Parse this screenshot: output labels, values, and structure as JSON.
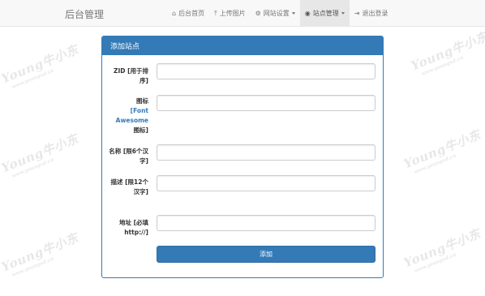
{
  "navbar": {
    "brand": "后台管理",
    "items": [
      {
        "label": "后台首页",
        "icon": "home-icon",
        "glyph": "⌂"
      },
      {
        "label": "上传图片",
        "icon": "upload-icon",
        "glyph": "⤒"
      },
      {
        "label": "网站设置",
        "icon": "gear-icon",
        "glyph": "⚙",
        "dropdown": true
      },
      {
        "label": "站点管理",
        "icon": "globe-icon",
        "glyph": "◉",
        "dropdown": true,
        "active": true
      },
      {
        "label": "退出登录",
        "icon": "sign-out-icon",
        "glyph": "⇥"
      }
    ]
  },
  "panel": {
    "title": "添加站点",
    "fields": [
      {
        "label_parts": [
          "ZID [用于排序]"
        ],
        "value": ""
      },
      {
        "label_before": "图标",
        "label_link": "[Font Awesome",
        "label_after": "图标]",
        "value": ""
      },
      {
        "label_parts": [
          "名称 [限6个汉字]"
        ],
        "value": ""
      },
      {
        "label_parts": [
          "描述 [限12个汉字]"
        ],
        "value": ""
      },
      {
        "label_parts": [
          "地址 [必填http://]"
        ],
        "value": ""
      }
    ],
    "submit_label": "添加"
  },
  "watermark": {
    "text": "Young牛小东",
    "sub": "www.youngxd.cn"
  },
  "colors": {
    "primary": "#337ab7",
    "navbar_bg": "#f8f8f8",
    "nav_active_bg": "#e7e7e7"
  }
}
